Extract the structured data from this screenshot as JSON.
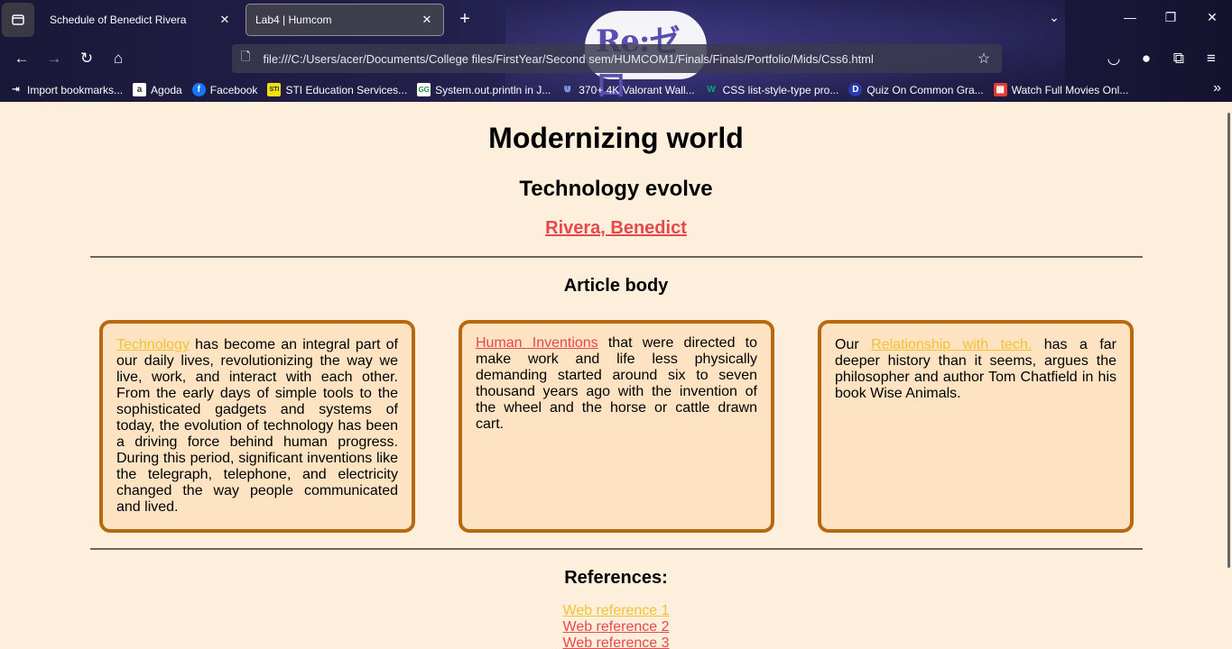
{
  "browser": {
    "tabs": [
      {
        "label": "Schedule of Benedict Rivera",
        "active": false
      },
      {
        "label": "Lab4 | Humcom",
        "active": true
      }
    ],
    "url": "file:///C:/Users/acer/Documents/College files/FirstYear/Second sem/HUMCOM1/Finals/Finals/Portfolio/Mids/Css6.html",
    "logo_text": "Re:ゼロ",
    "bookmarks": [
      {
        "label": "Import bookmarks...",
        "icon": "import-icon",
        "color": "#fbfbfe"
      },
      {
        "label": "Agoda",
        "icon": "agoda-icon",
        "color": "#ffffff"
      },
      {
        "label": "Facebook",
        "icon": "facebook-icon",
        "color": "#1877f2"
      },
      {
        "label": "STI Education Services...",
        "icon": "sti-icon",
        "color": "#f5e100"
      },
      {
        "label": "System.out.println in J...",
        "icon": "gfg-icon",
        "color": "#2f8d46"
      },
      {
        "label": "370+ 4K Valorant Wall...",
        "icon": "wallpaper-icon",
        "color": "#5a7fd6"
      },
      {
        "label": "CSS list-style-type pro...",
        "icon": "w3-icon",
        "color": "#04aa6d"
      },
      {
        "label": "Quiz On Common Gra...",
        "icon": "quiz-icon",
        "color": "#2a3bb0"
      },
      {
        "label": "Watch Full Movies Onl...",
        "icon": "movies-icon",
        "color": "#e53935"
      }
    ]
  },
  "page": {
    "title": "Modernizing world",
    "subtitle": "Technology evolve",
    "author": "Rivera, Benedict",
    "article_heading": "Article body",
    "cards": [
      {
        "link": "Technology",
        "link_color": "yellow",
        "text": " has become an integral part of our daily lives, revolutionizing the way we live, work, and interact with each other. From the early days of simple tools to the sophisticated gadgets and systems of today, the evolution of technology has been a driving force behind human progress. During this period, significant inventions like the telegraph, telephone, and electricity changed the way people communicated and lived."
      },
      {
        "link": "Human Inventions",
        "link_color": "red",
        "text": " that were directed to make work and life less physically demanding started around six to seven thousand years ago with the invention of the wheel and the horse or cattle drawn cart."
      },
      {
        "prefix": "Our ",
        "link": "Relationship with tech.",
        "link_color": "yellow",
        "text": " has a far deeper history than it seems, argues the philosopher and author Tom Chatfield in his book Wise Animals."
      }
    ],
    "references_heading": "References:",
    "references": [
      {
        "label": "Web reference 1",
        "color": "yellow"
      },
      {
        "label": "Web reference 2",
        "color": "red"
      },
      {
        "label": "Web reference 3",
        "color": "red"
      }
    ]
  }
}
